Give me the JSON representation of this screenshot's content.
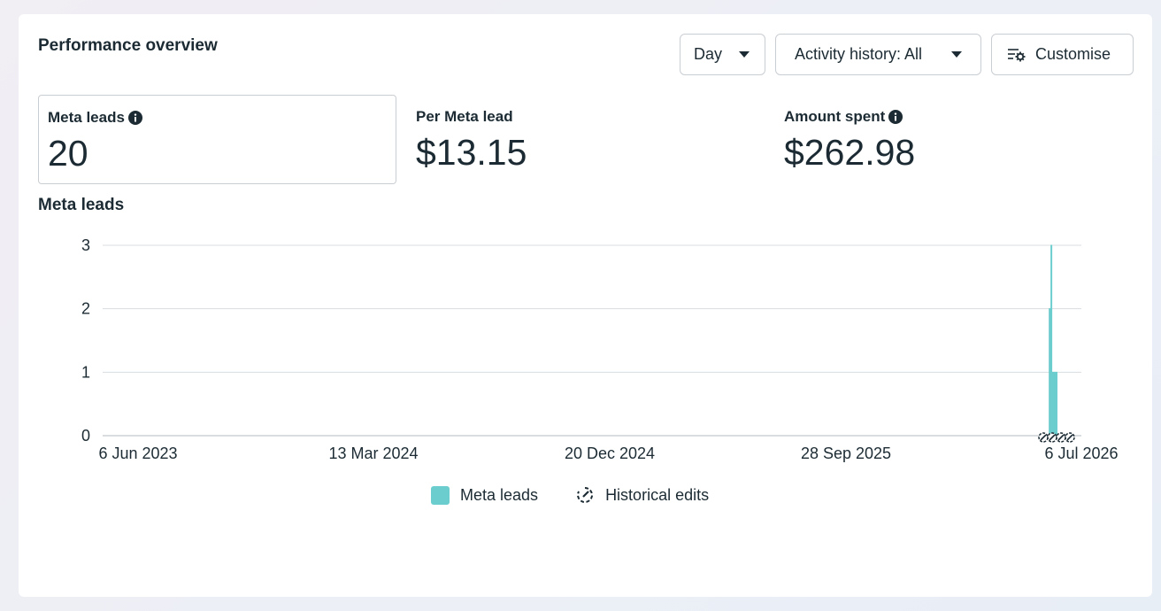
{
  "header": {
    "title": "Performance overview",
    "day_button": "Day",
    "activity_button": "Activity history: All",
    "customise_button": "Customise"
  },
  "metrics": [
    {
      "label": "Meta leads",
      "value": "20",
      "has_info": true,
      "selected": true
    },
    {
      "label": "Per Meta lead",
      "value": "$13.15",
      "has_info": false,
      "selected": false
    },
    {
      "label": "Amount spent",
      "value": "$262.98",
      "has_info": true,
      "selected": false
    }
  ],
  "chart_title": "Meta leads",
  "chart_data": {
    "type": "area",
    "title": "Meta leads",
    "xlabel": "",
    "ylabel": "",
    "ylim": [
      0,
      3
    ],
    "y_ticks": [
      "0",
      "1",
      "2",
      "3"
    ],
    "x_tick_labels": [
      "6 Jun 2023",
      "13 Mar 2024",
      "20 Dec 2024",
      "28 Sep 2025",
      "6 Jul 2026"
    ],
    "grid": true,
    "legend_placement": "bottom-center",
    "series": [
      {
        "name": "Meta leads",
        "color": "#6bcdcd",
        "points": [
          {
            "x": "2026-05-29",
            "y": 0
          },
          {
            "x": "2026-05-30",
            "y": 2
          },
          {
            "x": "2026-05-31",
            "y": 2
          },
          {
            "x": "2026-06-01",
            "y": 3
          },
          {
            "x": "2026-06-02",
            "y": 1
          },
          {
            "x": "2026-06-03",
            "y": 1
          },
          {
            "x": "2026-06-04",
            "y": 1
          },
          {
            "x": "2026-06-05",
            "y": 0
          },
          {
            "x": "2026-06-06",
            "y": 1
          },
          {
            "x": "2026-06-07",
            "y": 1
          },
          {
            "x": "2026-06-08",
            "y": 0
          }
        ]
      }
    ],
    "historical_edit_markers": 4
  },
  "legend": {
    "series_label": "Meta leads",
    "edits_label": "Historical edits",
    "edits_icon": "historical-edits-icon"
  }
}
